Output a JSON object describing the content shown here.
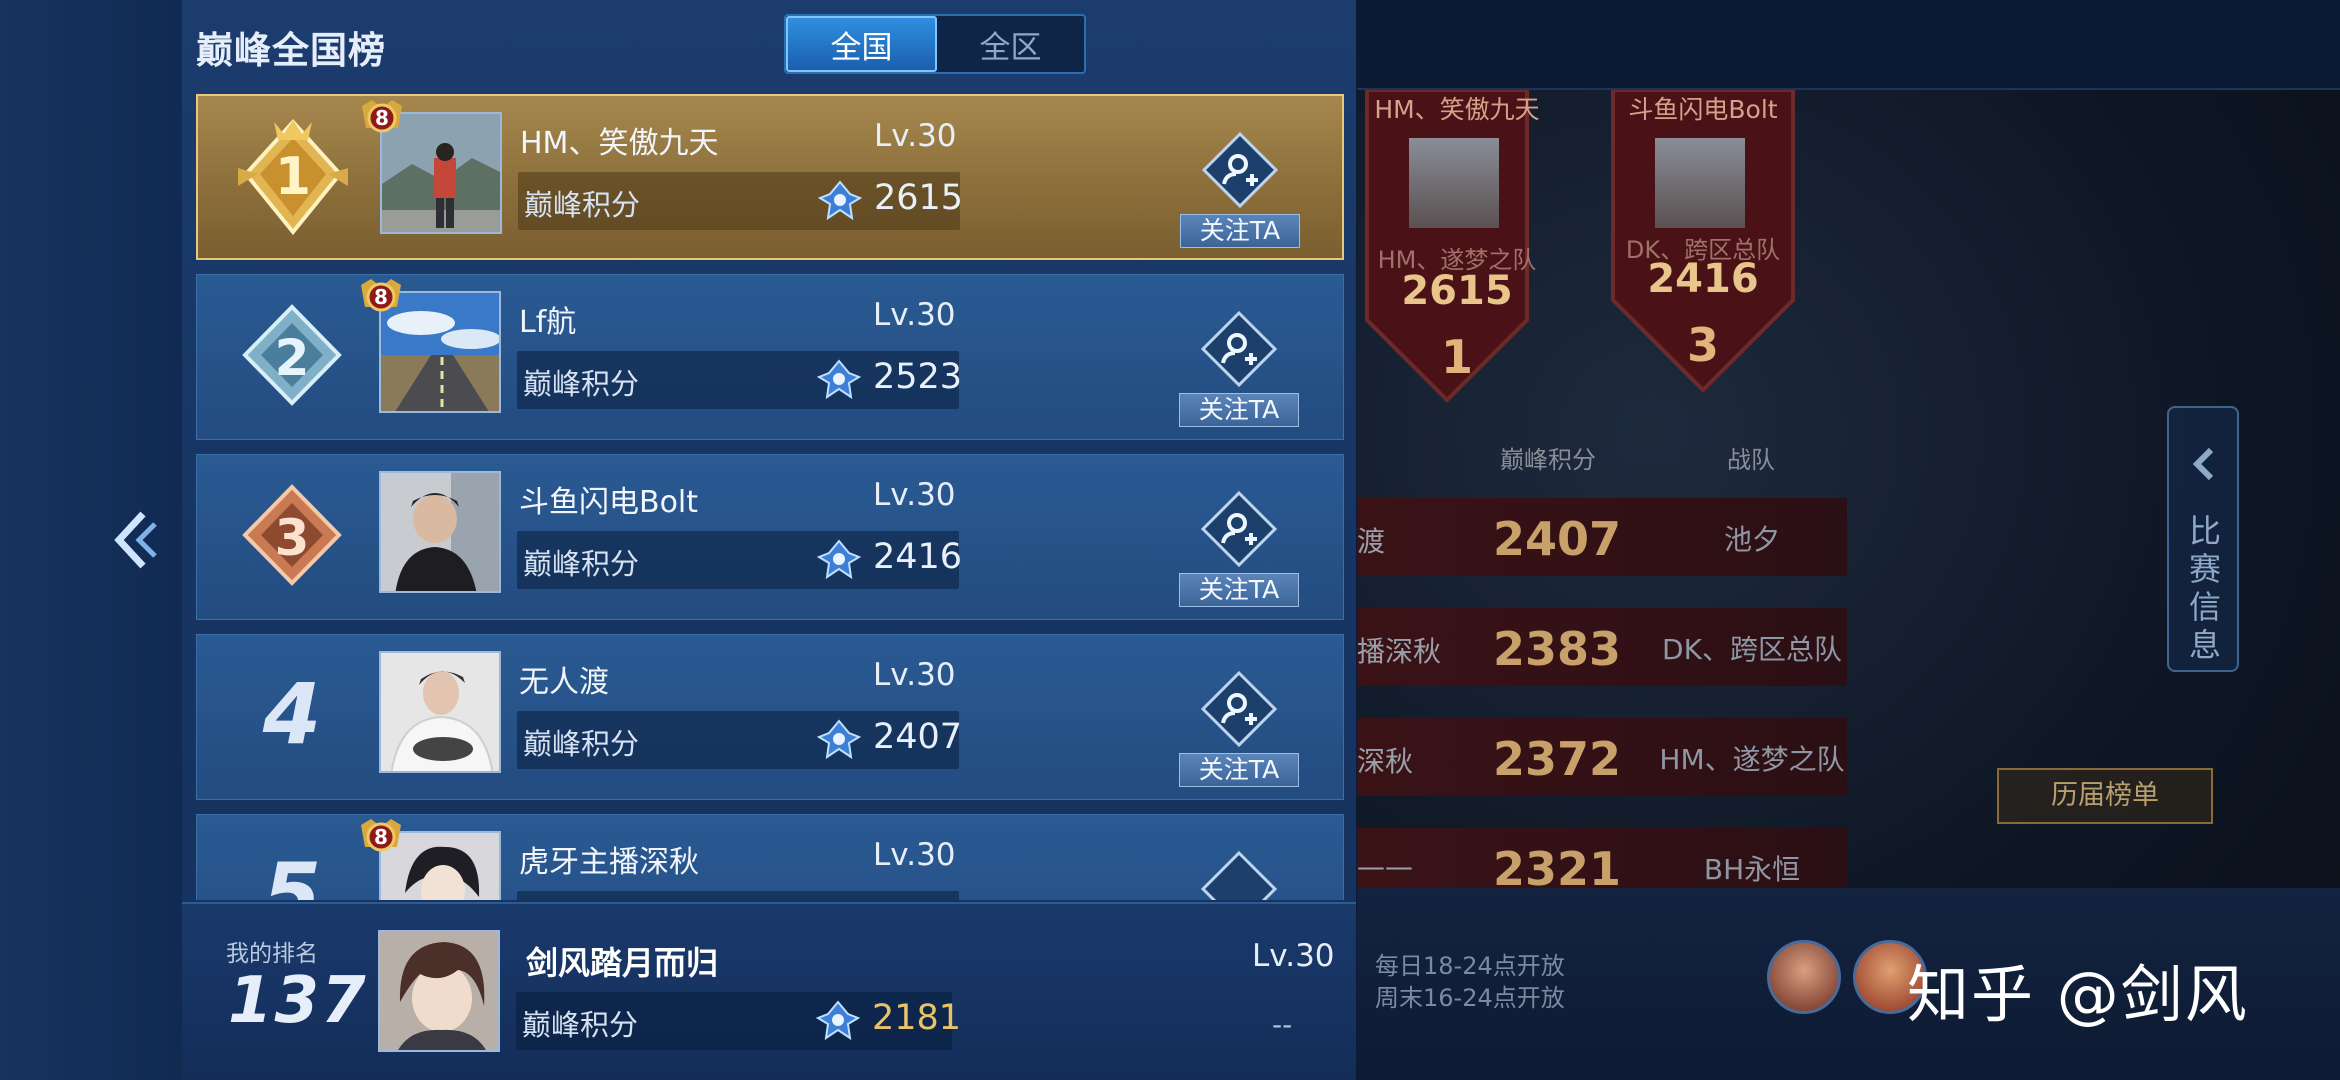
{
  "panel": {
    "title": "巅峰全国榜",
    "tabs": [
      {
        "label": "全国",
        "active": true
      },
      {
        "label": "全区",
        "active": false
      }
    ]
  },
  "score_label": "巅峰积分",
  "follow_label": "关注TA",
  "rows": [
    {
      "rank": "1",
      "name": "HM、笑傲九天",
      "level": "Lv.30",
      "score": "2615",
      "chip": "8"
    },
    {
      "rank": "2",
      "name": "Lf航",
      "level": "Lv.30",
      "score": "2523",
      "chip": "8"
    },
    {
      "rank": "3",
      "name": "斗鱼闪电Bolt",
      "level": "Lv.30",
      "score": "2416",
      "chip": ""
    },
    {
      "rank": "4",
      "name": "无人渡",
      "level": "Lv.30",
      "score": "2407",
      "chip": ""
    },
    {
      "rank": "5",
      "name": "虎牙主播深秋",
      "level": "Lv.30",
      "score": "",
      "chip": "8"
    }
  ],
  "my_rank": {
    "label": "我的排名",
    "rank": "137",
    "name": "剑风踏月而归",
    "level": "Lv.30",
    "score": "2181",
    "dash": "--"
  },
  "background": {
    "banners": [
      {
        "name": "HM、笑傲九天",
        "team": "HM、遂梦之队",
        "score": "2615",
        "rank": "1"
      },
      {
        "name": "斗鱼闪电Bolt",
        "team": "DK、跨区总队",
        "score": "2416",
        "rank": "3"
      }
    ],
    "headers": [
      "巅峰积分",
      "战队"
    ],
    "rows": [
      {
        "name": "渡",
        "score": "2407",
        "team": "池夕"
      },
      {
        "name": "播深秋",
        "score": "2383",
        "team": "DK、跨区总队"
      },
      {
        "name": "深秋",
        "score": "2372",
        "team": "HM、遂梦之队"
      },
      {
        "name": "——",
        "score": "2321",
        "team": "BH永恒"
      }
    ],
    "side_tab": "比赛信息",
    "history_button": "历届榜单",
    "open_times": [
      "每日18-24点开放",
      "周末16-24点开放"
    ],
    "watermark": "知乎 @剑风"
  },
  "colors": {
    "gold_row": "#a6874e",
    "blue_row": "#2a5a93",
    "accent": "#2f8fe0",
    "score_gold": "#e8c36a"
  }
}
